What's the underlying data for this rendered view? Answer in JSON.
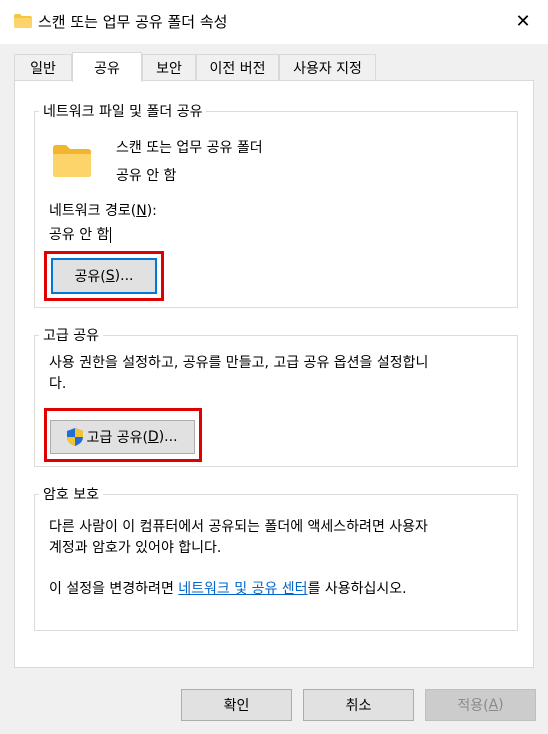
{
  "window": {
    "title": "스캔 또는 업무 공유 폴더 속성",
    "close_glyph": "✕"
  },
  "tabs": [
    {
      "label": "일반"
    },
    {
      "label": "공유"
    },
    {
      "label": "보안"
    },
    {
      "label": "이전 버전"
    },
    {
      "label": "사용자 지정"
    }
  ],
  "network_sharing": {
    "group_label": "네트워크 파일 및 폴더 공유",
    "folder_name": "스캔 또는 업무 공유 폴더",
    "share_status": "공유 안 함",
    "path_label_prefix": "네트워크 경로(",
    "path_label_key": "N",
    "path_label_suffix": "):",
    "path_value": "공유 안 함",
    "share_button_prefix": "공유(",
    "share_button_key": "S",
    "share_button_suffix": ")..."
  },
  "advanced_sharing": {
    "group_label": "고급 공유",
    "description": "사용 권한을 설정하고, 공유를 만들고, 고급 공유 옵션을 설정합니다.",
    "description_line1": "사용 권한을 설정하고, 공유를 만들고, 고급 공유 옵션을 설정합니",
    "description_line2": "다.",
    "button_prefix": "고급 공유(",
    "button_key": "D",
    "button_suffix": ")..."
  },
  "password_protection": {
    "group_label": "암호 보호",
    "line1": "다른 사람이 이 컴퓨터에서 공유되는 폴더에 액세스하려면 사용자",
    "line2": "계정과 암호가 있어야 합니다.",
    "sentence_prefix": "이 설정을 변경하려면 ",
    "link_text": "네트워크 및 공유 센터",
    "sentence_suffix": "를 사용하십시오."
  },
  "footer": {
    "ok_label": "확인",
    "cancel_label": "취소",
    "apply_prefix": "적용(",
    "apply_key": "A",
    "apply_suffix": ")"
  },
  "colors": {
    "highlight_box": "#e00000",
    "link": "#0066cc",
    "folder": "#f8c63d",
    "focus_border": "#0078d7"
  },
  "icons": {
    "title_folder": "folder-icon",
    "large_folder": "folder-icon",
    "shield": "uac-shield-icon"
  }
}
